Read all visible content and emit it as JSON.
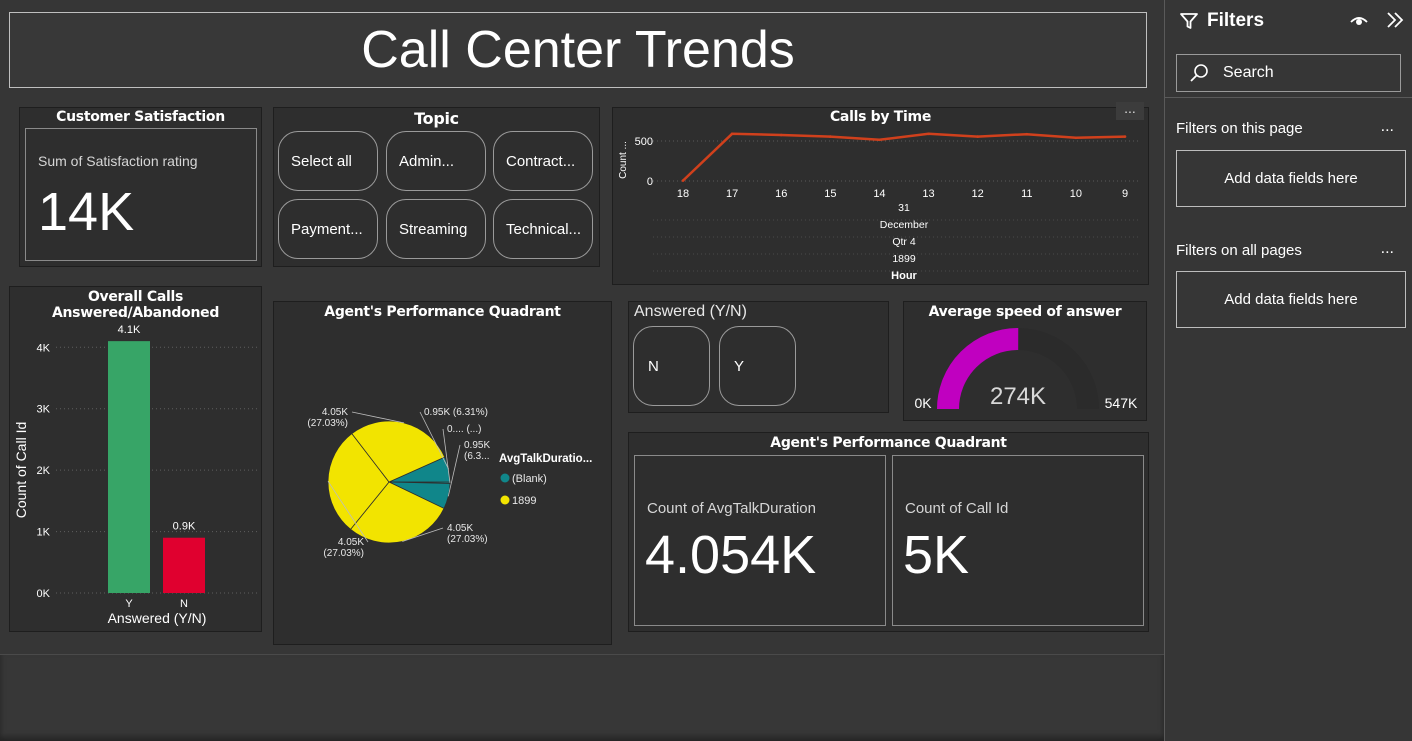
{
  "report": {
    "title": "Call Center Trends"
  },
  "customer_satisfaction": {
    "title": "Customer Satisfaction",
    "label": "Sum of Satisfaction rating",
    "value": "14K"
  },
  "topic_slicer": {
    "title": "Topic",
    "options": [
      "Select all",
      "Admin...",
      "Contract...",
      "Payment...",
      "Streaming",
      "Technical..."
    ]
  },
  "calls_by_time": {
    "title": "Calls by Time",
    "more_label": "...",
    "y_label": "Count ...",
    "x_hierarchy": [
      "31",
      "December",
      "Qtr 4",
      "1899",
      "Hour"
    ]
  },
  "overall_calls": {
    "title": "Overall Calls Answered/Abandoned",
    "y_label": "Count of Call Id",
    "x_label": "Answered (Y/N)"
  },
  "agent_pie": {
    "title": "Agent's Performance Quadrant",
    "legend_title": "AvgTalkDuratio...",
    "labels": [
      {
        "text1": "0.95K (6.31%)",
        "text2": ""
      },
      {
        "text1": "0.... (...)",
        "text2": ""
      },
      {
        "text1": "0.95K",
        "text2": "(6.3..."
      },
      {
        "text1": "4.05K",
        "text2": "(27.03%)"
      },
      {
        "text1": "4.05K",
        "text2": "(27.03%)"
      },
      {
        "text1": "4.05K",
        "text2": "(27.03%)"
      }
    ]
  },
  "answered_slicer": {
    "title": "Answered (Y/N)",
    "options": [
      "N",
      "Y"
    ]
  },
  "avg_speed": {
    "title": "Average speed of answer",
    "value": "274K",
    "min": "0K",
    "max": "547K",
    "fraction": 0.501,
    "fill_color": "#c000c0",
    "track_color": "#2b2b2b"
  },
  "agent_kpi": {
    "title": "Agent's Performance Quadrant",
    "cards": [
      {
        "label": "Count of AvgTalkDuration",
        "value": "4.054K"
      },
      {
        "label": "Count of Call Id",
        "value": "5K"
      }
    ]
  },
  "filters": {
    "title": "Filters",
    "search_placeholder": "Search",
    "sections": [
      {
        "label": "Filters on this page",
        "more": "...",
        "drop": "Add data fields here"
      },
      {
        "label": "Filters on all pages",
        "more": "...",
        "drop": "Add data fields here"
      }
    ]
  },
  "chart_data": [
    {
      "type": "line",
      "title": "Calls by Time",
      "x": [
        "18",
        "17",
        "16",
        "15",
        "14",
        "13",
        "12",
        "11",
        "10",
        "9"
      ],
      "series": [
        {
          "values": [
            5,
            590,
            575,
            555,
            515,
            590,
            555,
            585,
            540,
            555
          ],
          "color": "#d0401c"
        }
      ],
      "ylabel": "Count ...",
      "xlabel": "Hour",
      "yticks": [
        "0",
        "500"
      ],
      "ylim": [
        0,
        600
      ],
      "grid": true
    },
    {
      "type": "bar",
      "title": "Overall Calls Answered/Abandoned",
      "categories": [
        "Y",
        "N"
      ],
      "values": [
        4100,
        900
      ],
      "data_labels": [
        "4.1K",
        "0.9K"
      ],
      "colors": [
        "#37a567",
        "#e0002f"
      ],
      "yticks": [
        "0K",
        "1K",
        "2K",
        "3K",
        "4K"
      ],
      "ylim": [
        0,
        4200
      ],
      "xlabel": "Answered (Y/N)",
      "ylabel": "Count of Call Id",
      "grid": true
    },
    {
      "type": "pie",
      "title": "Agent's Performance Quadrant",
      "legend_title": "AvgTalkDuratio...",
      "legend": [
        {
          "name": "(Blank)",
          "color": "#10868a"
        },
        {
          "name": "1899",
          "color": "#f2e400"
        }
      ],
      "slices": [
        {
          "group": "(Blank)",
          "value": 950,
          "label": "0.95K (6.31%)",
          "color": "#10868a"
        },
        {
          "group": "(Blank)",
          "value": 50,
          "label": "0.... (...)",
          "color": "#10868a"
        },
        {
          "group": "(Blank)",
          "value": 950,
          "label": "0.95K (6.3...",
          "color": "#10868a"
        },
        {
          "group": "1899",
          "value": 4050,
          "label": "4.05K (27.03%)",
          "color": "#f2e400"
        },
        {
          "group": "1899",
          "value": 4050,
          "label": "4.05K (27.03%)",
          "color": "#f2e400"
        },
        {
          "group": "1899",
          "value": 4050,
          "label": "4.05K (27.03%)",
          "color": "#f2e400"
        }
      ]
    }
  ]
}
